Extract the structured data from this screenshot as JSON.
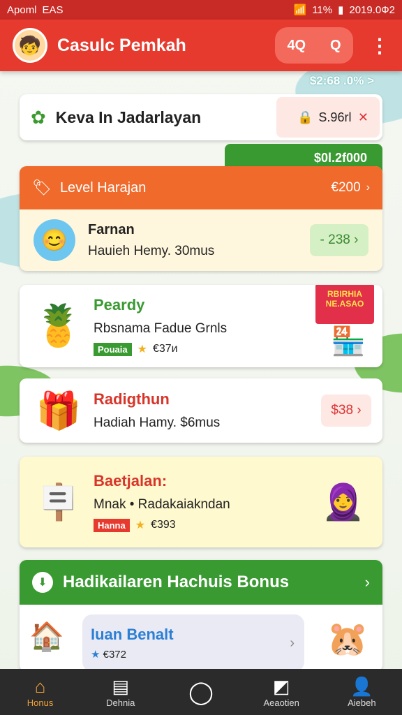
{
  "status": {
    "left_text": "Apoml",
    "left_icons": "EAS",
    "right_pct": "11%",
    "right_time": "2019.0Ф2"
  },
  "appbar": {
    "title": "Casulc Pemkah",
    "btn1": "4Q",
    "btn2": "Q",
    "menu": "⋮"
  },
  "subamount": "$2:68 .0% >",
  "search": {
    "label": "Keva In Jadarlayan",
    "price": "S.96rl"
  },
  "greentag": "$0l.2f000",
  "level": {
    "header": "Level Harajan",
    "header_amount": "€200",
    "title": "Farnan",
    "subtitle": "Hauieh Hemy. 30mus",
    "button": "- 238"
  },
  "pendy": {
    "title": "Peardy",
    "subtitle": "Rbsnama Fadue Grnls",
    "tag": "Pouaia",
    "rating": "€37и",
    "badge": "RBIRHIA NE.ASAO"
  },
  "gift": {
    "title": "Radigthun",
    "subtitle": "Hadiah Hamy. $6mus",
    "button": "$38"
  },
  "baet": {
    "title": "Baetjalan:",
    "subtitle": "Mnak • Radakaiakndan",
    "tag": "Hanna",
    "rating": "€393"
  },
  "bonus": {
    "header": "Hadikailaren Hachuis Bonus",
    "inner_title": "Iuan Benalt",
    "inner_rating": "€372"
  },
  "nav": [
    {
      "label": "Honus",
      "icon": "home-icon"
    },
    {
      "label": "Dehnia",
      "icon": "news-icon"
    },
    {
      "label": "",
      "icon": "search-icon"
    },
    {
      "label": "Aeaotien",
      "icon": "chart-icon"
    },
    {
      "label": "Aiebeh",
      "icon": "profile-icon"
    }
  ],
  "colors": {
    "primary": "#e63a2e",
    "green": "#3a9a32",
    "orange": "#ef6a2b"
  }
}
